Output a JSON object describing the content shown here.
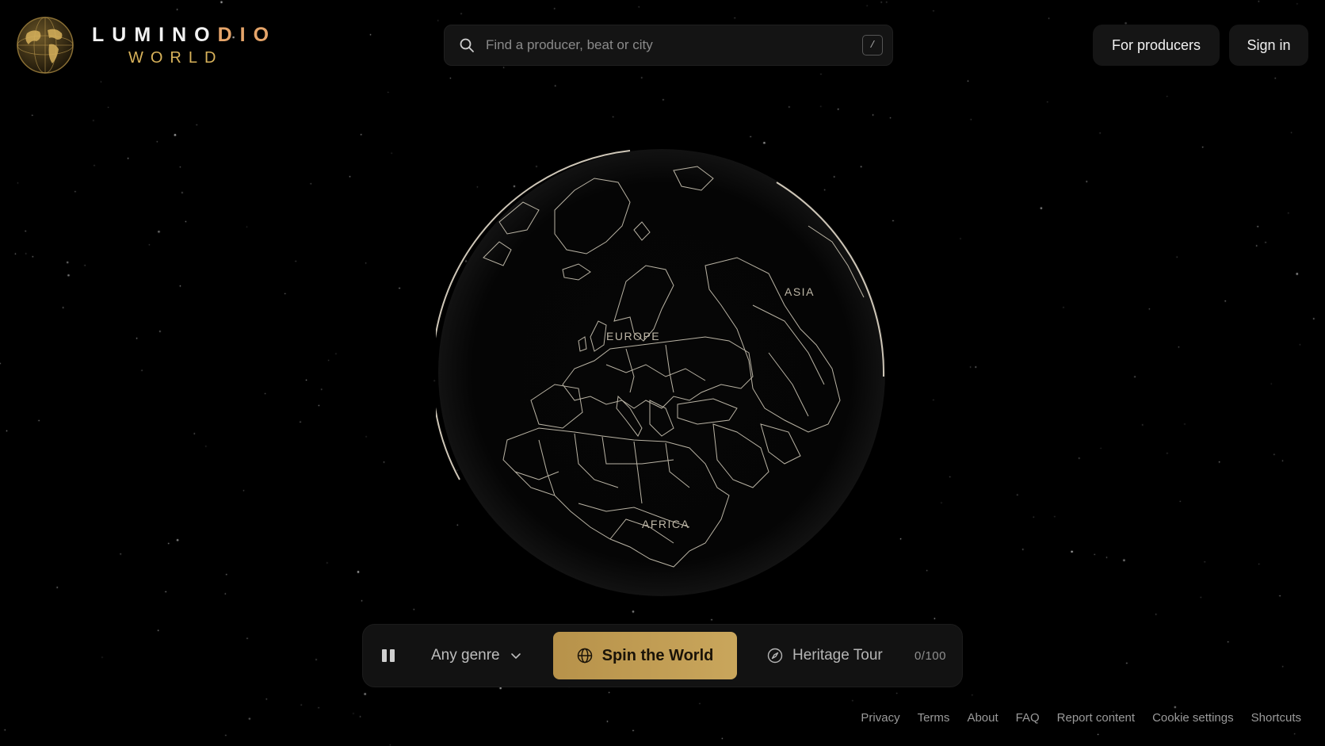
{
  "brand": {
    "line1_main": "LUMINO",
    "line1_accent": "DIO",
    "line2": "WORLD",
    "accent_color": "#e6a56a",
    "gold": "#d8b25a"
  },
  "search": {
    "placeholder": "Find a producer, beat or city",
    "value": "",
    "shortcut_key": "/",
    "icon": "search-icon"
  },
  "header": {
    "for_producers_label": "For producers",
    "sign_in_label": "Sign in"
  },
  "globe": {
    "labels": {
      "europe": "EUROPE",
      "asia": "ASIA",
      "africa": "AFRICA"
    },
    "line_color": "#d9d2c0"
  },
  "controls": {
    "pause_icon": "pause-icon",
    "genre_label": "Any genre",
    "spin_label": "Spin the World",
    "spin_color": "#c6a35a",
    "heritage_label": "Heritage Tour",
    "counter": "0/100"
  },
  "footer": {
    "links": [
      "Privacy",
      "Terms",
      "About",
      "FAQ",
      "Report content",
      "Cookie settings",
      "Shortcuts"
    ]
  }
}
